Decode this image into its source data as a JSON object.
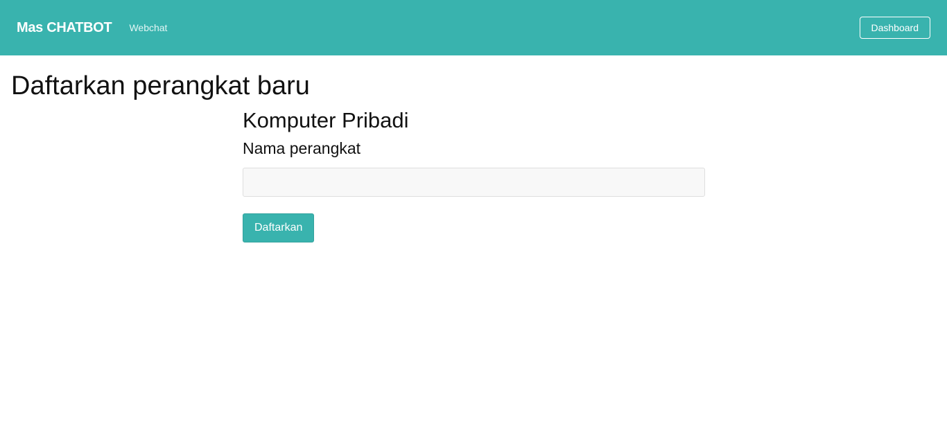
{
  "navbar": {
    "brand": "Mas CHATBOT",
    "links": [
      {
        "label": "Webchat"
      }
    ],
    "dashboard_button": "Dashboard",
    "background_color": "#39b3ae"
  },
  "page": {
    "title": "Daftarkan perangkat baru"
  },
  "form": {
    "section_title": "Komputer Pribadi",
    "device_name_label": "Nama perangkat",
    "device_name_value": "",
    "device_name_placeholder": "",
    "submit_label": "Daftarkan",
    "accent_color": "#39b3ae"
  }
}
